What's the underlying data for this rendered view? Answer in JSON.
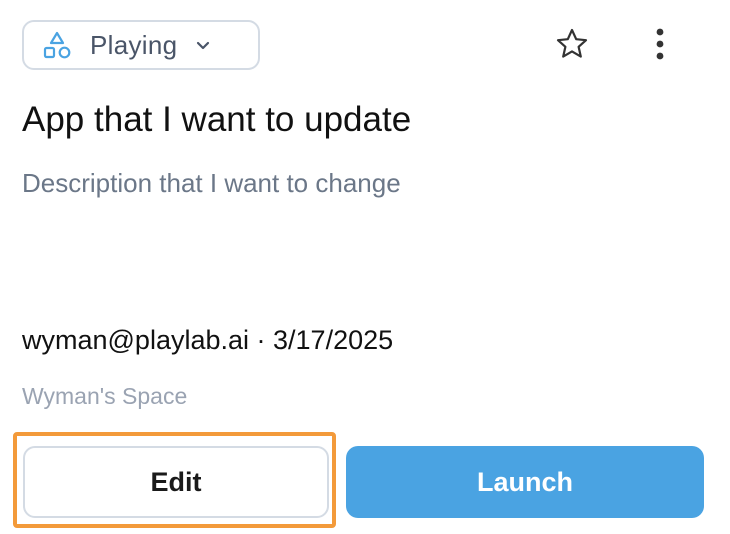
{
  "status": {
    "label": "Playing",
    "icon": "shapes-icon",
    "dropdown_icon": "chevron-down-icon",
    "accent_color": "#4aa3e2"
  },
  "actions": {
    "favorite_icon": "star-icon",
    "more_icon": "more-vertical-icon"
  },
  "app": {
    "title": "App that I want to update",
    "description": "Description that I want to change",
    "author": "wyman@playlab.ai",
    "separator": " · ",
    "date": "3/17/2025",
    "space": "Wyman's Space"
  },
  "buttons": {
    "edit_label": "Edit",
    "launch_label": "Launch",
    "launch_color": "#4aa3e2",
    "highlight_color": "#f39a3a"
  }
}
